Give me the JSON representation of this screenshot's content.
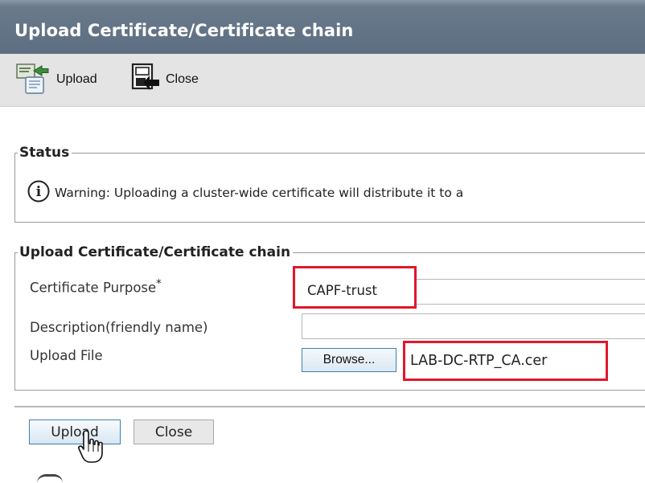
{
  "window": {
    "title": "Upload Certificate/Certificate chain"
  },
  "toolbar": {
    "upload_icon": "upload-icon",
    "upload_label": "Upload",
    "close_icon": "close-icon",
    "close_label": "Close"
  },
  "status": {
    "legend": "Status",
    "icon": "info-icon",
    "message": "Warning: Uploading a cluster-wide certificate will distribute it to a"
  },
  "upload_section": {
    "legend": "Upload Certificate/Certificate chain",
    "purpose_label": "Certificate Purpose",
    "required_marker": "*",
    "purpose_value": "CAPF-trust",
    "description_label": "Description(friendly name)",
    "description_value": "",
    "file_label": "Upload File",
    "browse_label": "Browse...",
    "file_name": "LAB-DC-RTP_CA.cer"
  },
  "actions": {
    "upload_label": "Upload",
    "close_label": "Close"
  },
  "colors": {
    "highlight": "#e0182a",
    "title_bar": "#5d6e82",
    "toolbar_bg": "#e4e4e4"
  }
}
